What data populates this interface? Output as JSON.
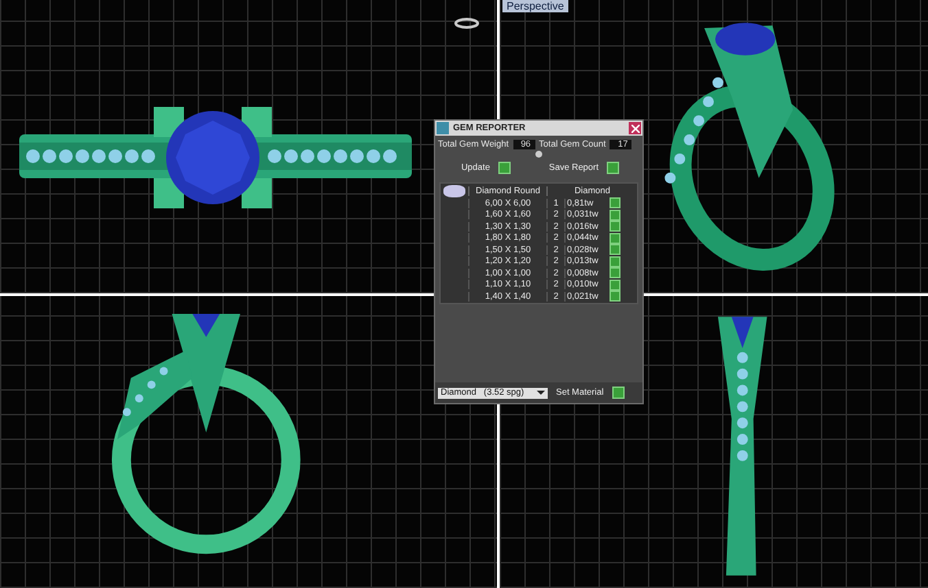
{
  "viewports": [
    {
      "kind": "top"
    },
    {
      "kind": "perspective",
      "label": "Perspective"
    },
    {
      "kind": "front"
    },
    {
      "kind": "right"
    }
  ],
  "gem_reporter": {
    "title": "GEM REPORTER",
    "total_gem_weight_label": "Total Gem Weight",
    "total_gem_weight": "96",
    "total_gem_count_label": "Total Gem Count",
    "total_gem_count": "17",
    "buttons": [
      {
        "label": "Update"
      },
      {
        "label": "Save Report"
      }
    ],
    "columns": [
      "Diamond Round",
      "Diamond"
    ],
    "rows": [
      {
        "size": "6,00 X 6,00",
        "count": "1",
        "weight": "0,81tw"
      },
      {
        "size": "1,60 X 1,60",
        "count": "2",
        "weight": "0,031tw"
      },
      {
        "size": "1,30 X 1,30",
        "count": "2",
        "weight": "0,016tw"
      },
      {
        "size": "1,80 X 1,80",
        "count": "2",
        "weight": "0,044tw"
      },
      {
        "size": "1,50 X 1,50",
        "count": "2",
        "weight": "0,028tw"
      },
      {
        "size": "1,20 X 1,20",
        "count": "2",
        "weight": "0,013tw"
      },
      {
        "size": "1,00 X 1,00",
        "count": "2",
        "weight": "0,008tw"
      },
      {
        "size": "1,10 X 1,10",
        "count": "2",
        "weight": "0,010tw"
      },
      {
        "size": "1,40 X 1,40",
        "count": "2",
        "weight": "0,021tw"
      }
    ],
    "material": "Diamond   (3.52 spg)",
    "set_material": "Set Material"
  }
}
